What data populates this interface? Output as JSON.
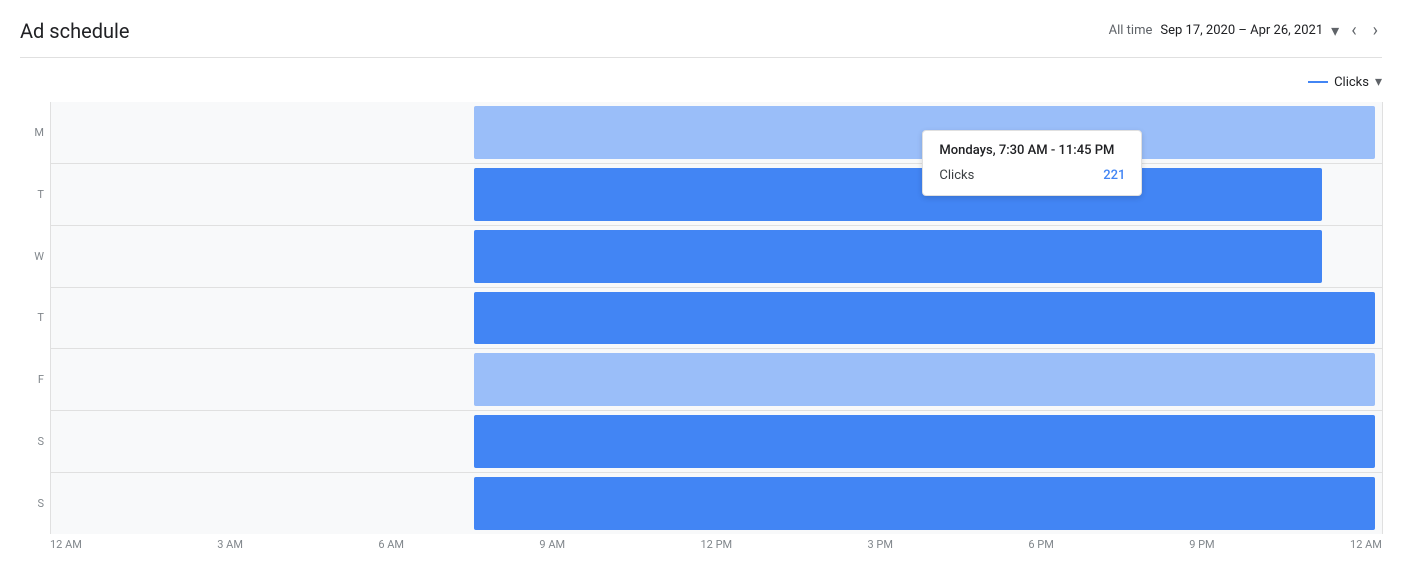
{
  "header": {
    "title": "Ad schedule",
    "all_time_label": "All time",
    "date_range": "Sep 17, 2020 – Apr 26, 2021"
  },
  "legend": {
    "label": "Clicks"
  },
  "tooltip": {
    "title": "Mondays, 7:30 AM - 11:45 PM",
    "metric": "Clicks",
    "value": "221"
  },
  "days": [
    {
      "label": "M"
    },
    {
      "label": "T"
    },
    {
      "label": "W"
    },
    {
      "label": "T"
    },
    {
      "label": "F"
    },
    {
      "label": "S"
    },
    {
      "label": "S"
    }
  ],
  "x_axis": {
    "labels": [
      "12 AM",
      "3 AM",
      "6 AM",
      "9 AM",
      "12 PM",
      "3 PM",
      "6 PM",
      "9 PM",
      "12 AM"
    ]
  }
}
